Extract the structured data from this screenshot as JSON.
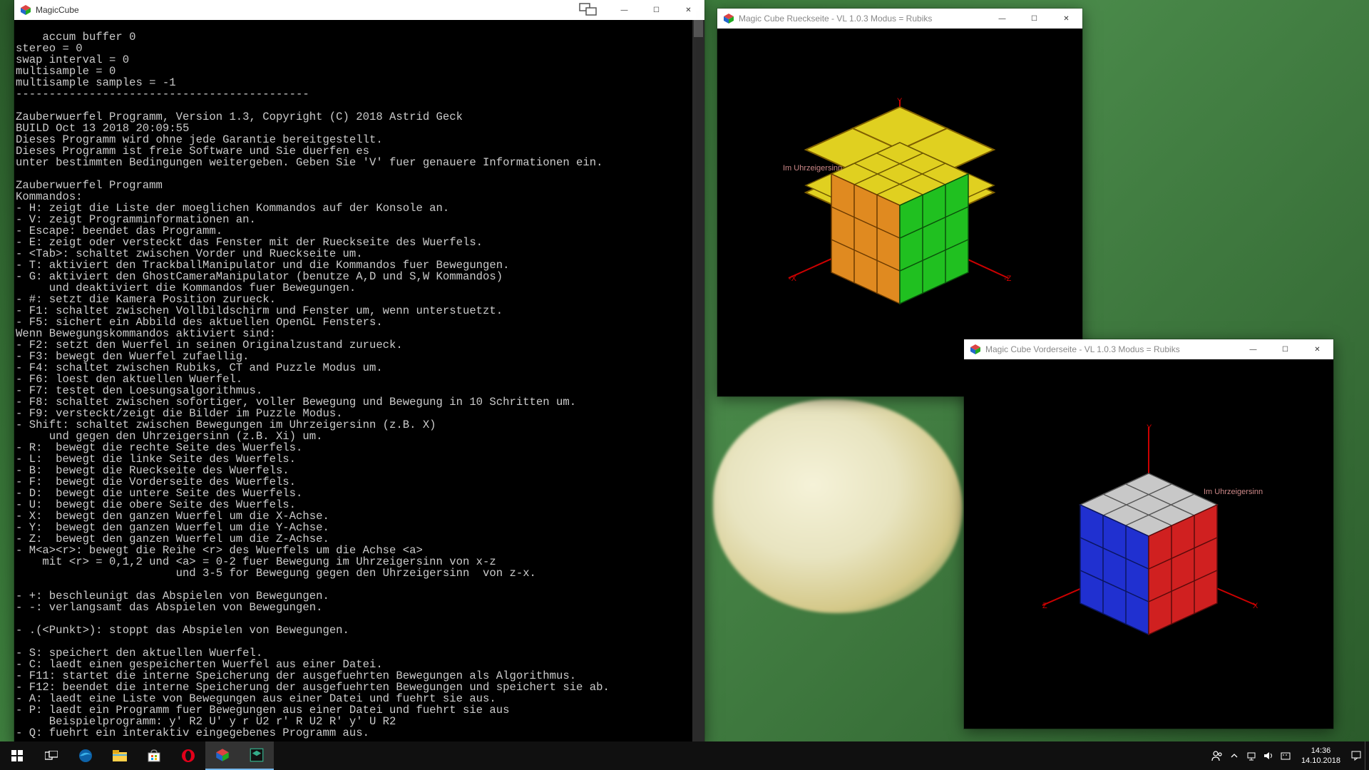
{
  "console": {
    "title": "MagicCube",
    "text": "accum buffer 0\nstereo = 0\nswap interval = 0\nmultisample = 0\nmultisample samples = -1\n--------------------------------------------\n\nZauberwuerfel Programm, Version 1.3, Copyright (C) 2018 Astrid Geck\nBUILD Oct 13 2018 20:09:55\nDieses Programm wird ohne jede Garantie bereitgestellt.\nDieses Programm ist freie Software und Sie duerfen es\nunter bestimmten Bedingungen weitergeben. Geben Sie 'V' fuer genauere Informationen ein.\n\nZauberwuerfel Programm\nKommandos:\n- H: zeigt die Liste der moeglichen Kommandos auf der Konsole an.\n- V: zeigt Programminformationen an.\n- Escape: beendet das Programm.\n- E: zeigt oder versteckt das Fenster mit der Rueckseite des Wuerfels.\n- <Tab>: schaltet zwischen Vorder und Rueckseite um.\n- T: aktiviert den TrackballManipulator und die Kommandos fuer Bewegungen.\n- G: aktiviert den GhostCameraManipulator (benutze A,D und S,W Kommandos)\n     und deaktiviert die Kommandos fuer Bewegungen.\n- #: setzt die Kamera Position zurueck.\n- F1: schaltet zwischen Vollbildschirm und Fenster um, wenn unterstuetzt.\n- F5: sichert ein Abbild des aktuellen OpenGL Fensters.\nWenn Bewegungskommandos aktiviert sind:\n- F2: setzt den Wuerfel in seinen Originalzustand zurueck.\n- F3: bewegt den Wuerfel zufaellig.\n- F4: schaltet zwischen Rubiks, CT and Puzzle Modus um.\n- F6: loest den aktuellen Wuerfel.\n- F7: testet den Loesungsalgorithmus.\n- F8: schaltet zwischen sofortiger, voller Bewegung und Bewegung in 10 Schritten um.\n- F9: versteckt/zeigt die Bilder im Puzzle Modus.\n- Shift: schaltet zwischen Bewegungen im Uhrzeigersinn (z.B. X)\n     und gegen den Uhrzeigersinn (z.B. Xi) um.\n- R:  bewegt die rechte Seite des Wuerfels.\n- L:  bewegt die linke Seite des Wuerfels.\n- B:  bewegt die Rueckseite des Wuerfels.\n- F:  bewegt die Vorderseite des Wuerfels.\n- D:  bewegt die untere Seite des Wuerfels.\n- U:  bewegt die obere Seite des Wuerfels.\n- X:  bewegt den ganzen Wuerfel um die X-Achse.\n- Y:  bewegt den ganzen Wuerfel um die Y-Achse.\n- Z:  bewegt den ganzen Wuerfel um die Z-Achse.\n- M<a><r>: bewegt die Reihe <r> des Wuerfels um die Achse <a>\n    mit <r> = 0,1,2 und <a> = 0-2 fuer Bewegung im Uhrzeigersinn von x-z\n                        und 3-5 for Bewegung gegen den Uhrzeigersinn  von z-x.\n\n- +: beschleunigt das Abspielen von Bewegungen.\n- -: verlangsamt das Abspielen von Bewegungen.\n\n- .(<Punkt>): stoppt das Abspielen von Bewegungen.\n\n- S: speichert den aktuellen Wuerfel.\n- C: laedt einen gespeicherten Wuerfel aus einer Datei.\n- F11: startet die interne Speicherung der ausgefuehrten Bewegungen als Algorithmus.\n- F12: beendet die interne Speicherung der ausgefuehrten Bewegungen und speichert sie ab.\n- A: laedt eine Liste von Bewegungen aus einer Datei und fuehrt sie aus.\n- P: laedt ein Programm fuer Bewegungen aus einer Datei und fuehrt sie aus\n     Beispielprogramm: y' R2 U' y r U2 r' R U2 R' y' U R2\n- Q: fuehrt ein interaktiv eingegebenes Programm aus."
  },
  "rueck": {
    "title": "Magic Cube Rueckseite - VL 1.0.3 Modus = Rubiks",
    "caption": "Im Uhrzeigersinn",
    "axes": {
      "x": "-X",
      "y": "Y",
      "z": "-Z"
    },
    "colors": {
      "top": "#e0d020",
      "left": "#e08a20",
      "right": "#20c020"
    }
  },
  "vorder": {
    "title": "Magic Cube Vorderseite - VL 1.0.3 Modus = Rubiks",
    "caption": "Im Uhrzeigersinn",
    "axes": {
      "x": "X",
      "y": "Y",
      "z": "Z"
    },
    "colors": {
      "top": "#c8c8c8",
      "left": "#2030d0",
      "right": "#d02020"
    }
  },
  "taskbar": {
    "time": "14:36",
    "date": "14.10.2018"
  },
  "window_controls": {
    "min": "—",
    "max": "☐",
    "close": "✕"
  }
}
